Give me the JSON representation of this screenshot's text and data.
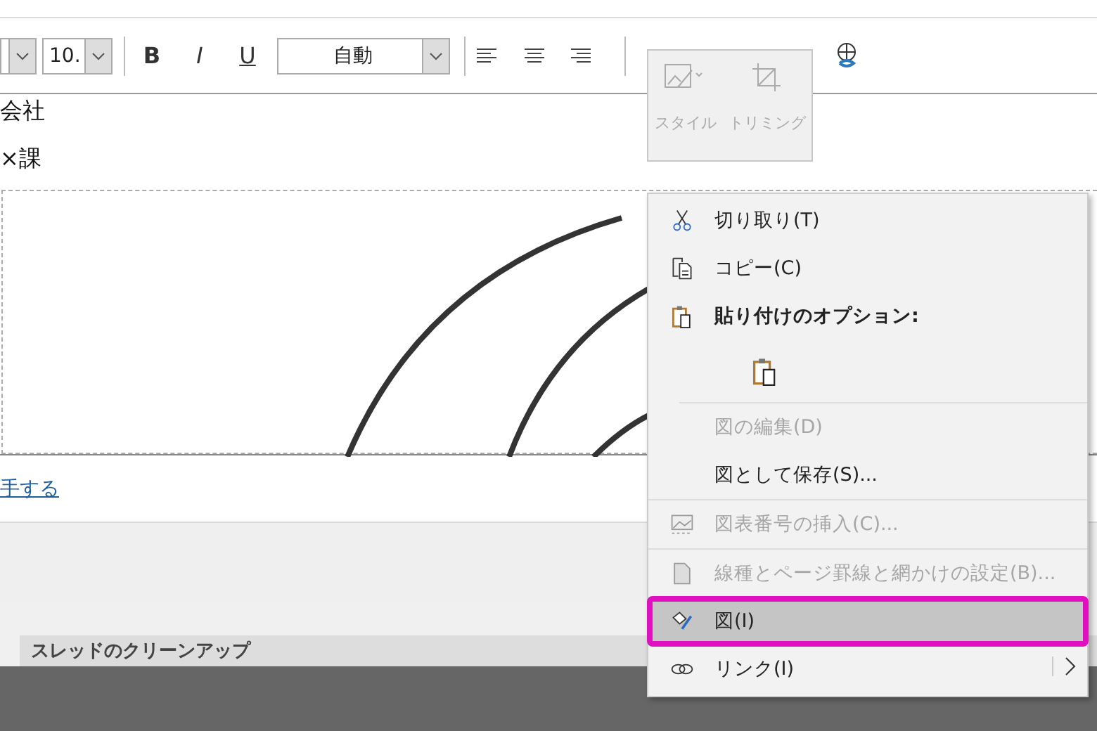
{
  "toolbar": {
    "font_size": "10.",
    "bold": "B",
    "italic": "I",
    "underline": "U",
    "font_color_label": "自動"
  },
  "document": {
    "lines": [
      "会社",
      "×課"
    ],
    "link": "手する"
  },
  "section": {
    "title": "スレッドのクリーンアップ"
  },
  "mini_toolbar": {
    "buttons": [
      {
        "label": "スタイル",
        "kind": "style",
        "disabled": true
      },
      {
        "label": "トリミング",
        "kind": "crop",
        "disabled": true
      }
    ]
  },
  "context_menu": {
    "items": [
      {
        "kind": "cut",
        "label": "切り取り(T)",
        "disabled": false,
        "selected": false
      },
      {
        "kind": "copy",
        "label": "コピー(C)",
        "disabled": false,
        "selected": false
      },
      {
        "kind": "paste-header",
        "label": "貼り付けのオプション:"
      },
      {
        "kind": "paste-option"
      },
      {
        "kind": "edit",
        "label": "図の編集(D)",
        "disabled": true,
        "selected": false
      },
      {
        "kind": "save",
        "label": "図として保存(S)...",
        "disabled": false,
        "selected": false
      },
      {
        "kind": "caption",
        "label": "図表番号の挿入(C)...",
        "disabled": true,
        "selected": false
      },
      {
        "kind": "borders",
        "label": "線種とページ罫線と網かけの設定(B)...",
        "disabled": true,
        "selected": false
      },
      {
        "kind": "format",
        "label": "図(I)",
        "disabled": false,
        "selected": true
      },
      {
        "kind": "link",
        "label": "リンク(I)",
        "disabled": false,
        "selected": false,
        "submenu": true
      }
    ]
  }
}
